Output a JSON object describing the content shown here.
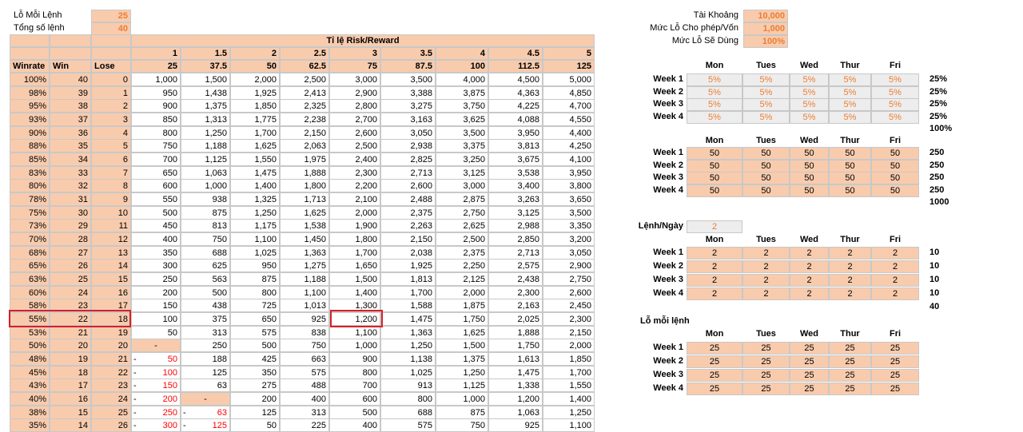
{
  "inputs": {
    "loss_per_order_label": "Lỗ Mỗi Lệnh",
    "loss_per_order_value": "25",
    "total_orders_label": "Tổng số lệnh",
    "total_orders_value": "40"
  },
  "table": {
    "rr_title": "Tỉ lệ Risk/Reward",
    "ratios": [
      "1",
      "1.5",
      "2",
      "2.5",
      "3",
      "3.5",
      "4",
      "4.5",
      "5"
    ],
    "rewards": [
      "25",
      "37.5",
      "50",
      "62.5",
      "75",
      "87.5",
      "100",
      "112.5",
      "125"
    ],
    "col_headers": [
      "Winrate",
      "Win",
      "Lose"
    ],
    "rows": [
      {
        "winrate": "100%",
        "win": "40",
        "lose": "0",
        "vals": [
          "1,000",
          "1,500",
          "2,000",
          "2,500",
          "3,000",
          "3,500",
          "4,000",
          "4,500",
          "5,000"
        ]
      },
      {
        "winrate": "98%",
        "win": "39",
        "lose": "1",
        "vals": [
          "950",
          "1,438",
          "1,925",
          "2,413",
          "2,900",
          "3,388",
          "3,875",
          "4,363",
          "4,850"
        ]
      },
      {
        "winrate": "95%",
        "win": "38",
        "lose": "2",
        "vals": [
          "900",
          "1,375",
          "1,850",
          "2,325",
          "2,800",
          "3,275",
          "3,750",
          "4,225",
          "4,700"
        ]
      },
      {
        "winrate": "93%",
        "win": "37",
        "lose": "3",
        "vals": [
          "850",
          "1,313",
          "1,775",
          "2,238",
          "2,700",
          "3,163",
          "3,625",
          "4,088",
          "4,550"
        ]
      },
      {
        "winrate": "90%",
        "win": "36",
        "lose": "4",
        "vals": [
          "800",
          "1,250",
          "1,700",
          "2,150",
          "2,600",
          "3,050",
          "3,500",
          "3,950",
          "4,400"
        ]
      },
      {
        "winrate": "88%",
        "win": "35",
        "lose": "5",
        "vals": [
          "750",
          "1,188",
          "1,625",
          "2,063",
          "2,500",
          "2,938",
          "3,375",
          "3,813",
          "4,250"
        ]
      },
      {
        "winrate": "85%",
        "win": "34",
        "lose": "6",
        "vals": [
          "700",
          "1,125",
          "1,550",
          "1,975",
          "2,400",
          "2,825",
          "3,250",
          "3,675",
          "4,100"
        ]
      },
      {
        "winrate": "83%",
        "win": "33",
        "lose": "7",
        "vals": [
          "650",
          "1,063",
          "1,475",
          "1,888",
          "2,300",
          "2,713",
          "3,125",
          "3,538",
          "3,950"
        ]
      },
      {
        "winrate": "80%",
        "win": "32",
        "lose": "8",
        "vals": [
          "600",
          "1,000",
          "1,400",
          "1,800",
          "2,200",
          "2,600",
          "3,000",
          "3,400",
          "3,800"
        ]
      },
      {
        "winrate": "78%",
        "win": "31",
        "lose": "9",
        "vals": [
          "550",
          "938",
          "1,325",
          "1,713",
          "2,100",
          "2,488",
          "2,875",
          "3,263",
          "3,650"
        ]
      },
      {
        "winrate": "75%",
        "win": "30",
        "lose": "10",
        "vals": [
          "500",
          "875",
          "1,250",
          "1,625",
          "2,000",
          "2,375",
          "2,750",
          "3,125",
          "3,500"
        ]
      },
      {
        "winrate": "73%",
        "win": "29",
        "lose": "11",
        "vals": [
          "450",
          "813",
          "1,175",
          "1,538",
          "1,900",
          "2,263",
          "2,625",
          "2,988",
          "3,350"
        ]
      },
      {
        "winrate": "70%",
        "win": "28",
        "lose": "12",
        "vals": [
          "400",
          "750",
          "1,100",
          "1,450",
          "1,800",
          "2,150",
          "2,500",
          "2,850",
          "3,200"
        ]
      },
      {
        "winrate": "68%",
        "win": "27",
        "lose": "13",
        "vals": [
          "350",
          "688",
          "1,025",
          "1,363",
          "1,700",
          "2,038",
          "2,375",
          "2,713",
          "3,050"
        ]
      },
      {
        "winrate": "65%",
        "win": "26",
        "lose": "14",
        "vals": [
          "300",
          "625",
          "950",
          "1,275",
          "1,650",
          "1,925",
          "2,250",
          "2,575",
          "2,900"
        ]
      },
      {
        "winrate": "63%",
        "win": "25",
        "lose": "15",
        "vals": [
          "250",
          "563",
          "875",
          "1,188",
          "1,500",
          "1,813",
          "2,125",
          "2,438",
          "2,750"
        ]
      },
      {
        "winrate": "60%",
        "win": "24",
        "lose": "16",
        "vals": [
          "200",
          "500",
          "800",
          "1,100",
          "1,400",
          "1,700",
          "2,000",
          "2,300",
          "2,600"
        ]
      },
      {
        "winrate": "58%",
        "win": "23",
        "lose": "17",
        "vals": [
          "150",
          "438",
          "725",
          "1,013",
          "1,300",
          "1,588",
          "1,875",
          "2,163",
          "2,450"
        ]
      },
      {
        "winrate": "55%",
        "win": "22",
        "lose": "18",
        "vals": [
          "100",
          "375",
          "650",
          "925",
          "1,200",
          "1,475",
          "1,750",
          "2,025",
          "2,300"
        ]
      },
      {
        "winrate": "53%",
        "win": "21",
        "lose": "19",
        "vals": [
          "50",
          "313",
          "575",
          "838",
          "1,100",
          "1,363",
          "1,625",
          "1,888",
          "2,150"
        ]
      },
      {
        "winrate": "50%",
        "win": "20",
        "lose": "20",
        "vals": [
          "-",
          "250",
          "500",
          "750",
          "1,000",
          "1,250",
          "1,500",
          "1,750",
          "2,000"
        ]
      },
      {
        "winrate": "48%",
        "win": "19",
        "lose": "21",
        "vals": [
          "50",
          "188",
          "425",
          "663",
          "900",
          "1,138",
          "1,375",
          "1,613",
          "1,850"
        ]
      },
      {
        "winrate": "45%",
        "win": "18",
        "lose": "22",
        "vals": [
          "100",
          "125",
          "350",
          "575",
          "800",
          "1,025",
          "1,250",
          "1,475",
          "1,700"
        ]
      },
      {
        "winrate": "43%",
        "win": "17",
        "lose": "23",
        "vals": [
          "150",
          "63",
          "275",
          "488",
          "700",
          "913",
          "1,125",
          "1,338",
          "1,550"
        ]
      },
      {
        "winrate": "40%",
        "win": "16",
        "lose": "24",
        "vals": [
          "200",
          "-",
          "200",
          "400",
          "600",
          "800",
          "1,000",
          "1,200",
          "1,400"
        ]
      },
      {
        "winrate": "38%",
        "win": "15",
        "lose": "25",
        "vals": [
          "250",
          "63",
          "125",
          "313",
          "500",
          "688",
          "875",
          "1,063",
          "1,250"
        ]
      },
      {
        "winrate": "35%",
        "win": "14",
        "lose": "26",
        "vals": [
          "300",
          "125",
          "50",
          "225",
          "400",
          "575",
          "750",
          "925",
          "1,100"
        ]
      }
    ],
    "neg_prefix": "-"
  },
  "account": {
    "balance_label": "Tài Khoảng",
    "balance_value": "10,000",
    "loss_cap_label": "Mức Lỗ Cho phép/Vốn",
    "loss_cap_value": "1,000",
    "loss_used_label": "Mức Lỗ Sẽ Dùng",
    "loss_used_value": "100%"
  },
  "days": [
    "Mon",
    "Tues",
    "Wed",
    "Thur",
    "Fri"
  ],
  "weeks": [
    "Week 1",
    "Week 2",
    "Week 3",
    "Week 4"
  ],
  "pct_block": {
    "cells": [
      "5%",
      "5%",
      "5%",
      "5%",
      "5%"
    ],
    "row_totals": [
      "25%",
      "25%",
      "25%",
      "25%"
    ],
    "grand_total": "100%"
  },
  "money_block": {
    "cells": [
      "50",
      "50",
      "50",
      "50",
      "50"
    ],
    "row_totals": [
      "250",
      "250",
      "250",
      "250"
    ],
    "grand_total": "1000"
  },
  "orders_block": {
    "per_day_label": "Lệnh/Ngày",
    "per_day_value": "2",
    "cells": [
      "2",
      "2",
      "2",
      "2",
      "2"
    ],
    "row_totals": [
      "10",
      "10",
      "10",
      "10"
    ],
    "grand_total": "40"
  },
  "loss_block": {
    "title": "Lỗ mỗi lệnh",
    "cells": [
      "25",
      "25",
      "25",
      "25",
      "25"
    ]
  }
}
